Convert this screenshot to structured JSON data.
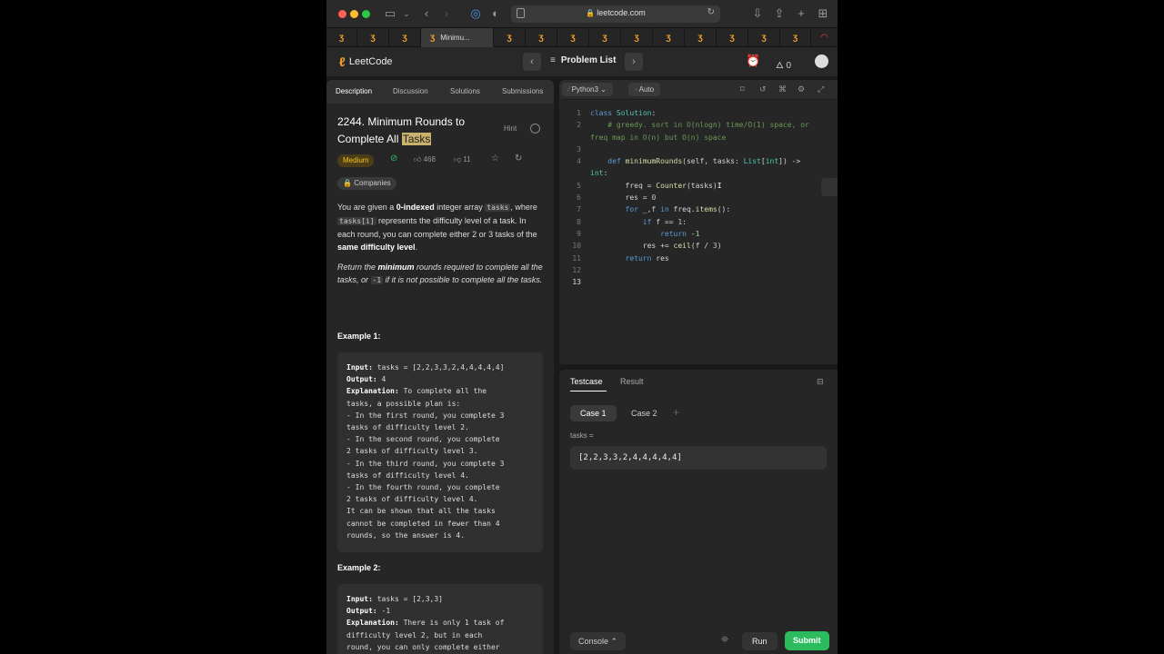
{
  "browser": {
    "url": "leetcode.com",
    "active_tab_label": "Minimu..."
  },
  "nav": {
    "logo_text": "LeetCode",
    "problem_list": "Problem List",
    "streak_count": "0"
  },
  "left_tabs": [
    "Description",
    "Discussion",
    "Solutions",
    "Submissions"
  ],
  "problem": {
    "title_main": "2244. Minimum Rounds to Complete All ",
    "title_highlight": "Tasks",
    "hint": "Hint",
    "difficulty": "Medium",
    "likes": "468",
    "dislikes": "11",
    "companies": "Companies"
  },
  "description": {
    "p1_a": "You are given a ",
    "p1_b": "0-indexed",
    "p1_c": " integer array ",
    "p1_code1": "tasks",
    "p1_d": ", where ",
    "p1_code2": "tasks[i]",
    "p1_e": " represents the difficulty level of a task. In each round, you can complete either 2 or 3 tasks of the ",
    "p1_f": "same difficulty level",
    "p1_g": ".",
    "p2_a": "Return the ",
    "p2_b": "minimum",
    "p2_c": " rounds required to complete all the tasks, or ",
    "p2_code": "-1",
    "p2_d": " if it is not possible to complete all the tasks."
  },
  "example1": {
    "title": "Example 1:",
    "input_k": "Input:",
    "input_v": " tasks = [2,2,3,3,2,4,4,4,4,4]",
    "output_k": "Output:",
    "output_v": " 4",
    "expl_k": "Explanation:",
    "lines": [
      " To complete all the",
      "tasks, a possible plan is:",
      "- In the first round, you complete 3",
      "tasks of difficulty level 2.",
      "- In the second round, you complete",
      "2 tasks of difficulty level 3.",
      "- In the third round, you complete 3",
      "tasks of difficulty level 4.",
      "- In the fourth round, you complete",
      "2 tasks of difficulty level 4.",
      "It can be shown that all the tasks",
      "cannot be completed in fewer than 4",
      "rounds, so the answer is 4."
    ]
  },
  "example2": {
    "title": "Example 2:",
    "input_k": "Input:",
    "input_v": " tasks = [2,3,3]",
    "output_k": "Output:",
    "output_v": " -1",
    "expl_k": "Explanation:",
    "lines": [
      " There is only 1 task of",
      "difficulty level 2, but in each",
      "round, you can only complete either"
    ]
  },
  "editor": {
    "language": "Python3",
    "mode": "Auto",
    "line_numbers": [
      "1",
      "2",
      "",
      "3",
      "4",
      "",
      "5",
      "6",
      "7",
      "8",
      "9",
      "10",
      "11",
      "12",
      "13"
    ]
  },
  "testcase": {
    "tab_testcase": "Testcase",
    "tab_result": "Result",
    "case1": "Case 1",
    "case2": "Case 2",
    "add": "+",
    "label": "tasks =",
    "value": "[2,2,3,3,2,4,4,4,4,4]",
    "console": "Console",
    "run": "Run",
    "submit": "Submit"
  },
  "colors": {
    "submit_green": "#2cbb5d",
    "difficulty_yellow": "#f5c518",
    "leetcode_orange": "#f0a12b"
  }
}
